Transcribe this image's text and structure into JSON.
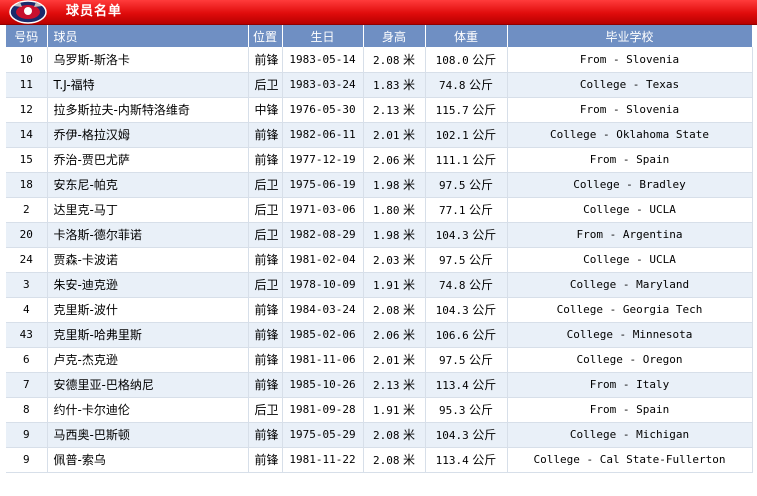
{
  "title": "球员名单",
  "headers": [
    "号码",
    "球员",
    "位置",
    "生日",
    "身高",
    "体重",
    "毕业学校"
  ],
  "units": {
    "height": "米",
    "weight": "公斤"
  },
  "players": [
    {
      "number": "10",
      "name": "乌罗斯-斯洛卡",
      "position": "前锋",
      "birthday": "1983-05-14",
      "height": "2.08",
      "weight": "108.0",
      "school": "From - Slovenia"
    },
    {
      "number": "11",
      "name": "T.J-福特",
      "position": "后卫",
      "birthday": "1983-03-24",
      "height": "1.83",
      "weight": "74.8",
      "school": "College - Texas"
    },
    {
      "number": "12",
      "name": "拉多斯拉夫-内斯特洛维奇",
      "position": "中锋",
      "birthday": "1976-05-30",
      "height": "2.13",
      "weight": "115.7",
      "school": "From - Slovenia"
    },
    {
      "number": "14",
      "name": "乔伊-格拉汉姆",
      "position": "前锋",
      "birthday": "1982-06-11",
      "height": "2.01",
      "weight": "102.1",
      "school": "College - Oklahoma State"
    },
    {
      "number": "15",
      "name": "乔治-贾巴尤萨",
      "position": "前锋",
      "birthday": "1977-12-19",
      "height": "2.06",
      "weight": "111.1",
      "school": "From - Spain"
    },
    {
      "number": "18",
      "name": "安东尼-帕克",
      "position": "后卫",
      "birthday": "1975-06-19",
      "height": "1.98",
      "weight": "97.5",
      "school": "College - Bradley"
    },
    {
      "number": "2",
      "name": "达里克-马丁",
      "position": "后卫",
      "birthday": "1971-03-06",
      "height": "1.80",
      "weight": "77.1",
      "school": "College - UCLA"
    },
    {
      "number": "20",
      "name": "卡洛斯-德尔菲诺",
      "position": "后卫",
      "birthday": "1982-08-29",
      "height": "1.98",
      "weight": "104.3",
      "school": "From - Argentina"
    },
    {
      "number": "24",
      "name": "贾森-卡波诺",
      "position": "前锋",
      "birthday": "1981-02-04",
      "height": "2.03",
      "weight": "97.5",
      "school": "College - UCLA"
    },
    {
      "number": "3",
      "name": "朱安-迪克逊",
      "position": "后卫",
      "birthday": "1978-10-09",
      "height": "1.91",
      "weight": "74.8",
      "school": "College - Maryland"
    },
    {
      "number": "4",
      "name": "克里斯-波什",
      "position": "前锋",
      "birthday": "1984-03-24",
      "height": "2.08",
      "weight": "104.3",
      "school": "College - Georgia Tech"
    },
    {
      "number": "43",
      "name": "克里斯-哈弗里斯",
      "position": "前锋",
      "birthday": "1985-02-06",
      "height": "2.06",
      "weight": "106.6",
      "school": "College - Minnesota"
    },
    {
      "number": "6",
      "name": "卢克-杰克逊",
      "position": "前锋",
      "birthday": "1981-11-06",
      "height": "2.01",
      "weight": "97.5",
      "school": "College - Oregon"
    },
    {
      "number": "7",
      "name": "安德里亚-巴格纳尼",
      "position": "前锋",
      "birthday": "1985-10-26",
      "height": "2.13",
      "weight": "113.4",
      "school": "From - Italy"
    },
    {
      "number": "8",
      "name": "约什-卡尔迪伦",
      "position": "后卫",
      "birthday": "1981-09-28",
      "height": "1.91",
      "weight": "95.3",
      "school": "From - Spain"
    },
    {
      "number": "9",
      "name": "马西奥-巴斯顿",
      "position": "前锋",
      "birthday": "1975-05-29",
      "height": "2.08",
      "weight": "104.3",
      "school": "College - Michigan"
    },
    {
      "number": "9",
      "name": "佩普-索乌",
      "position": "前锋",
      "birthday": "1981-11-22",
      "height": "2.08",
      "weight": "113.4",
      "school": "College - Cal State-Fullerton"
    }
  ]
}
